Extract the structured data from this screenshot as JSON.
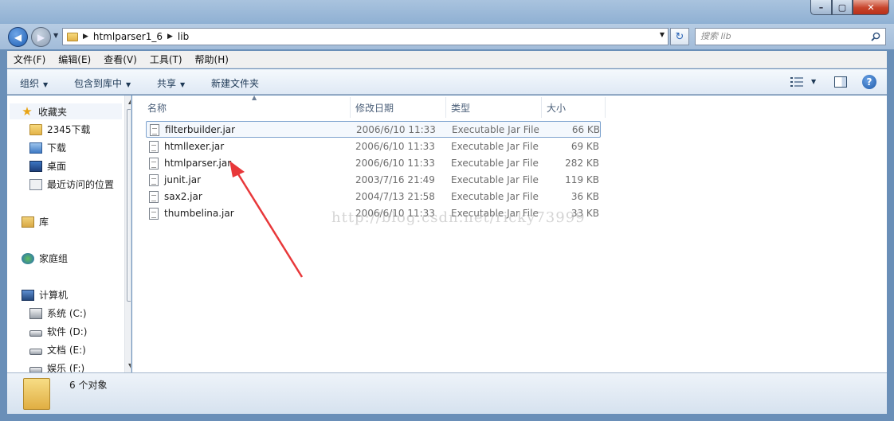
{
  "window": {
    "title_ghost": "",
    "controls": {
      "minimize": "–",
      "maximize": "▢",
      "close": "✕"
    }
  },
  "address": {
    "crumbs": [
      "htmlparser1_6",
      "lib"
    ]
  },
  "search": {
    "placeholder": "搜索 lib"
  },
  "menu": [
    "文件(F)",
    "编辑(E)",
    "查看(V)",
    "工具(T)",
    "帮助(H)"
  ],
  "commands": {
    "organize": "组织",
    "include_library": "包含到库中",
    "share": "共享",
    "new_folder": "新建文件夹"
  },
  "nav": {
    "favorites": "收藏夹",
    "fav_items": [
      "2345下载",
      "下载",
      "桌面",
      "最近访问的位置"
    ],
    "libraries": "库",
    "homegroup": "家庭组",
    "computer": "计算机",
    "drives": [
      "系统 (C:)",
      "软件 (D:)",
      "文档 (E:)",
      "娱乐 (F:)"
    ]
  },
  "columns": {
    "name": "名称",
    "date": "修改日期",
    "type": "类型",
    "size": "大小"
  },
  "files": [
    {
      "name": "filterbuilder.jar",
      "date": "2006/6/10 11:33",
      "type": "Executable Jar File",
      "size": "66 KB"
    },
    {
      "name": "htmllexer.jar",
      "date": "2006/6/10 11:33",
      "type": "Executable Jar File",
      "size": "69 KB"
    },
    {
      "name": "htmlparser.jar",
      "date": "2006/6/10 11:33",
      "type": "Executable Jar File",
      "size": "282 KB"
    },
    {
      "name": "junit.jar",
      "date": "2003/7/16 21:49",
      "type": "Executable Jar File",
      "size": "119 KB"
    },
    {
      "name": "sax2.jar",
      "date": "2004/7/13 21:58",
      "type": "Executable Jar File",
      "size": "36 KB"
    },
    {
      "name": "thumbelina.jar",
      "date": "2006/6/10 11:33",
      "type": "Executable Jar File",
      "size": "33 KB"
    }
  ],
  "watermark": "http://blog.csdn.net/ricky73999",
  "status": {
    "count": "6 个对象"
  },
  "colors": {
    "annotation_arrow": "#e8383a",
    "selection_border": "#7da2ce"
  }
}
